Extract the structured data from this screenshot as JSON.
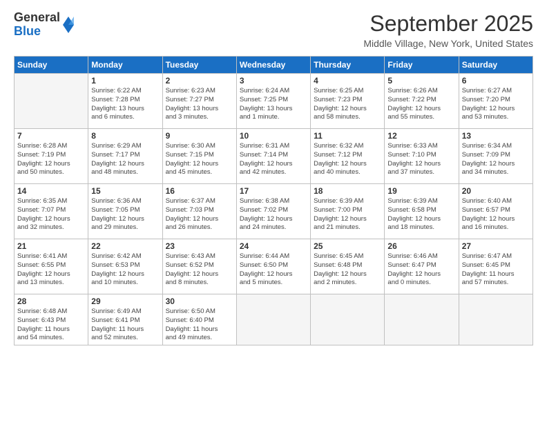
{
  "logo": {
    "general": "General",
    "blue": "Blue"
  },
  "title": "September 2025",
  "location": "Middle Village, New York, United States",
  "days_header": [
    "Sunday",
    "Monday",
    "Tuesday",
    "Wednesday",
    "Thursday",
    "Friday",
    "Saturday"
  ],
  "weeks": [
    [
      {
        "day": "",
        "info": ""
      },
      {
        "day": "1",
        "info": "Sunrise: 6:22 AM\nSunset: 7:28 PM\nDaylight: 13 hours\nand 6 minutes."
      },
      {
        "day": "2",
        "info": "Sunrise: 6:23 AM\nSunset: 7:27 PM\nDaylight: 13 hours\nand 3 minutes."
      },
      {
        "day": "3",
        "info": "Sunrise: 6:24 AM\nSunset: 7:25 PM\nDaylight: 13 hours\nand 1 minute."
      },
      {
        "day": "4",
        "info": "Sunrise: 6:25 AM\nSunset: 7:23 PM\nDaylight: 12 hours\nand 58 minutes."
      },
      {
        "day": "5",
        "info": "Sunrise: 6:26 AM\nSunset: 7:22 PM\nDaylight: 12 hours\nand 55 minutes."
      },
      {
        "day": "6",
        "info": "Sunrise: 6:27 AM\nSunset: 7:20 PM\nDaylight: 12 hours\nand 53 minutes."
      }
    ],
    [
      {
        "day": "7",
        "info": "Sunrise: 6:28 AM\nSunset: 7:19 PM\nDaylight: 12 hours\nand 50 minutes."
      },
      {
        "day": "8",
        "info": "Sunrise: 6:29 AM\nSunset: 7:17 PM\nDaylight: 12 hours\nand 48 minutes."
      },
      {
        "day": "9",
        "info": "Sunrise: 6:30 AM\nSunset: 7:15 PM\nDaylight: 12 hours\nand 45 minutes."
      },
      {
        "day": "10",
        "info": "Sunrise: 6:31 AM\nSunset: 7:14 PM\nDaylight: 12 hours\nand 42 minutes."
      },
      {
        "day": "11",
        "info": "Sunrise: 6:32 AM\nSunset: 7:12 PM\nDaylight: 12 hours\nand 40 minutes."
      },
      {
        "day": "12",
        "info": "Sunrise: 6:33 AM\nSunset: 7:10 PM\nDaylight: 12 hours\nand 37 minutes."
      },
      {
        "day": "13",
        "info": "Sunrise: 6:34 AM\nSunset: 7:09 PM\nDaylight: 12 hours\nand 34 minutes."
      }
    ],
    [
      {
        "day": "14",
        "info": "Sunrise: 6:35 AM\nSunset: 7:07 PM\nDaylight: 12 hours\nand 32 minutes."
      },
      {
        "day": "15",
        "info": "Sunrise: 6:36 AM\nSunset: 7:05 PM\nDaylight: 12 hours\nand 29 minutes."
      },
      {
        "day": "16",
        "info": "Sunrise: 6:37 AM\nSunset: 7:03 PM\nDaylight: 12 hours\nand 26 minutes."
      },
      {
        "day": "17",
        "info": "Sunrise: 6:38 AM\nSunset: 7:02 PM\nDaylight: 12 hours\nand 24 minutes."
      },
      {
        "day": "18",
        "info": "Sunrise: 6:39 AM\nSunset: 7:00 PM\nDaylight: 12 hours\nand 21 minutes."
      },
      {
        "day": "19",
        "info": "Sunrise: 6:39 AM\nSunset: 6:58 PM\nDaylight: 12 hours\nand 18 minutes."
      },
      {
        "day": "20",
        "info": "Sunrise: 6:40 AM\nSunset: 6:57 PM\nDaylight: 12 hours\nand 16 minutes."
      }
    ],
    [
      {
        "day": "21",
        "info": "Sunrise: 6:41 AM\nSunset: 6:55 PM\nDaylight: 12 hours\nand 13 minutes."
      },
      {
        "day": "22",
        "info": "Sunrise: 6:42 AM\nSunset: 6:53 PM\nDaylight: 12 hours\nand 10 minutes."
      },
      {
        "day": "23",
        "info": "Sunrise: 6:43 AM\nSunset: 6:52 PM\nDaylight: 12 hours\nand 8 minutes."
      },
      {
        "day": "24",
        "info": "Sunrise: 6:44 AM\nSunset: 6:50 PM\nDaylight: 12 hours\nand 5 minutes."
      },
      {
        "day": "25",
        "info": "Sunrise: 6:45 AM\nSunset: 6:48 PM\nDaylight: 12 hours\nand 2 minutes."
      },
      {
        "day": "26",
        "info": "Sunrise: 6:46 AM\nSunset: 6:47 PM\nDaylight: 12 hours\nand 0 minutes."
      },
      {
        "day": "27",
        "info": "Sunrise: 6:47 AM\nSunset: 6:45 PM\nDaylight: 11 hours\nand 57 minutes."
      }
    ],
    [
      {
        "day": "28",
        "info": "Sunrise: 6:48 AM\nSunset: 6:43 PM\nDaylight: 11 hours\nand 54 minutes."
      },
      {
        "day": "29",
        "info": "Sunrise: 6:49 AM\nSunset: 6:41 PM\nDaylight: 11 hours\nand 52 minutes."
      },
      {
        "day": "30",
        "info": "Sunrise: 6:50 AM\nSunset: 6:40 PM\nDaylight: 11 hours\nand 49 minutes."
      },
      {
        "day": "",
        "info": ""
      },
      {
        "day": "",
        "info": ""
      },
      {
        "day": "",
        "info": ""
      },
      {
        "day": "",
        "info": ""
      }
    ]
  ]
}
